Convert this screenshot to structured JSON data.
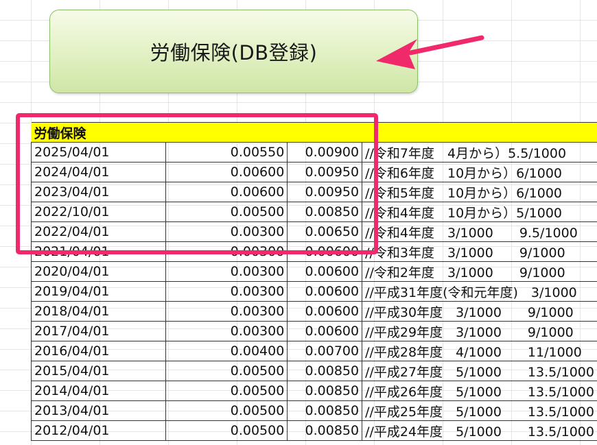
{
  "callout": {
    "title": "労働保険(DB登録)"
  },
  "sheet": {
    "header": "労働保険",
    "rows": [
      {
        "date": "2025/04/01",
        "rate1": "0.00550",
        "rate2": "0.00900",
        "memo": "//令和7年度　4月から）5.5/1000"
      },
      {
        "date": "2024/04/01",
        "rate1": "0.00600",
        "rate2": "0.00950",
        "memo": "//令和6年度　10月から）6/1000"
      },
      {
        "date": "2023/04/01",
        "rate1": "0.00600",
        "rate2": "0.00950",
        "memo": "//令和5年度　10月から）6/1000"
      },
      {
        "date": "2022/10/01",
        "rate1": "0.00500",
        "rate2": "0.00850",
        "memo": "//令和4年度　10月から）5/1000"
      },
      {
        "date": "2022/04/01",
        "rate1": "0.00300",
        "rate2": "0.00650",
        "memo": "//令和4年度　3/1000　　9.5/1000"
      },
      {
        "date": "2021/04/01",
        "rate1": "0.00300",
        "rate2": "0.00600",
        "memo": "//令和3年度　3/1000　　9/1000"
      },
      {
        "date": "2020/04/01",
        "rate1": "0.00300",
        "rate2": "0.00600",
        "memo": "//令和2年度　3/1000　　9/1000"
      },
      {
        "date": "2019/04/01",
        "rate1": "0.00300",
        "rate2": "0.00600",
        "memo": "//平成31年度(令和元年度)　3/1000"
      },
      {
        "date": "2018/04/01",
        "rate1": "0.00300",
        "rate2": "0.00600",
        "memo": "//平成30年度　3/1000　　9/1000"
      },
      {
        "date": "2017/04/01",
        "rate1": "0.00300",
        "rate2": "0.00600",
        "memo": "//平成29年度　3/1000　　9/1000"
      },
      {
        "date": "2016/04/01",
        "rate1": "0.00400",
        "rate2": "0.00700",
        "memo": "//平成28年度　4/1000　　11/1000"
      },
      {
        "date": "2015/04/01",
        "rate1": "0.00500",
        "rate2": "0.00850",
        "memo": "//平成27年度　5/1000　　13.5/1000"
      },
      {
        "date": "2014/04/01",
        "rate1": "0.00500",
        "rate2": "0.00850",
        "memo": "//平成26年度　5/1000　　13.5/1000"
      },
      {
        "date": "2013/04/01",
        "rate1": "0.00500",
        "rate2": "0.00850",
        "memo": "//平成25年度　5/1000　　13.5/1000"
      },
      {
        "date": "2012/04/01",
        "rate1": "0.00500",
        "rate2": "0.00850",
        "memo": "//平成24年度　5/1000　　13.5/1000"
      }
    ]
  },
  "colors": {
    "highlight": "#f02a6a",
    "header_fill": "#ffff00",
    "callout_fill": "#e1f0c2"
  },
  "icons": {
    "arrow": "arrow-left-icon"
  }
}
